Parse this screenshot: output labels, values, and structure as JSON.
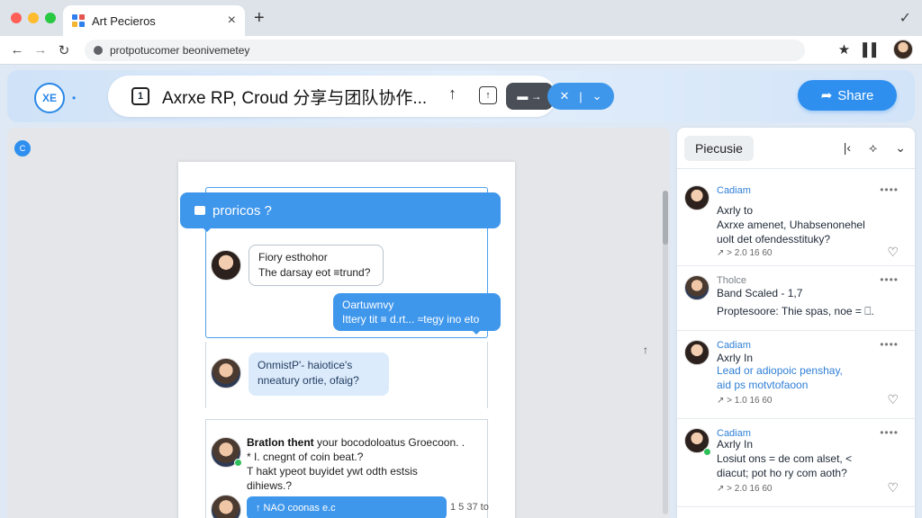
{
  "browser": {
    "tab_title": "Art Pecieros",
    "tab_close": "×",
    "new_tab": "+",
    "check": "✓",
    "back": "←",
    "forward": "→",
    "reload": "↻",
    "url": "protpotucomer beonivemetey",
    "star": "★",
    "ext": "▌▌"
  },
  "header": {
    "logo_text": "XE",
    "logo_dots": "•",
    "doc_icon_label": "1",
    "doc_title": "Axrxe RP, Croud 分享与团队协作...",
    "up_arrow": "↑",
    "upload_glyph": "↑",
    "present_glyph": "▬ →",
    "collab_icon": "✕",
    "collab_divider": "|",
    "collab_chevron": "⌄",
    "share_icon": "➦",
    "share_label": "Share"
  },
  "canvas": {
    "badge": "C",
    "side_marker": "↑",
    "topic": "proricos ?",
    "bubble_white": [
      "Fiory esthohor",
      "The darsay eot ≡trund?"
    ],
    "bubble_blue": [
      "Oartuwnvy",
      "Ittery tit ≡ d.rt... ≈tegy ino eto"
    ],
    "bubble_light": [
      "OnmistP'- haiotice's",
      "nneatury ortie, ofaig?"
    ],
    "comment_bold": "Bratlon thent",
    "comment_lines": [
      "your bocodoloatus Groecoon. .",
      "* I. cnegnt of coin beat.?",
      "T hakt ypeot buyidet ywt odth estsis",
      "dihiews.? "
    ],
    "reply_label": "↑ NAO  coonas e.c",
    "reply_count": "1 5 37 to"
  },
  "panel": {
    "title": "Piecusie",
    "tool_collapse": "|‹",
    "tool_move": "⟡",
    "tool_filter": "⌄",
    "threads": [
      {
        "author": "Cadiam",
        "line1": "Axrly to",
        "line2": "Axrxe amenet, Uhabsenonehel",
        "line3": "uolt det ofendesstituky?",
        "meta": "↗  > 2.0     16 60",
        "more": "••••",
        "heart": "♡"
      },
      {
        "author": "Tholce",
        "line1": "Band Scaled -  1,7",
        "line2": "",
        "line3": "Proptesoore:  Thie spas, noe = ⎕.",
        "meta": "",
        "more": "••••",
        "heart": ""
      },
      {
        "author": "Cadiam",
        "line1": "Axrly In",
        "line2": "Lead or adiopoic penshay,",
        "line3": "aid ps motvtofaoon",
        "meta": "↗  > 1.0     16 60",
        "more": "••••",
        "heart": "♡"
      },
      {
        "author": "Cadiam",
        "line1": "Axrly In",
        "line2": "Losiut ons = de com alset, <",
        "line3": "diacut; pot ho ry com aoth?",
        "meta": "↗  > 2.0     16 60",
        "more": "••••",
        "heart": "♡"
      }
    ]
  },
  "colors": {
    "accent": "#2f8fef",
    "page_bg": "#dfe9f5",
    "online": "#2fbf5b"
  }
}
